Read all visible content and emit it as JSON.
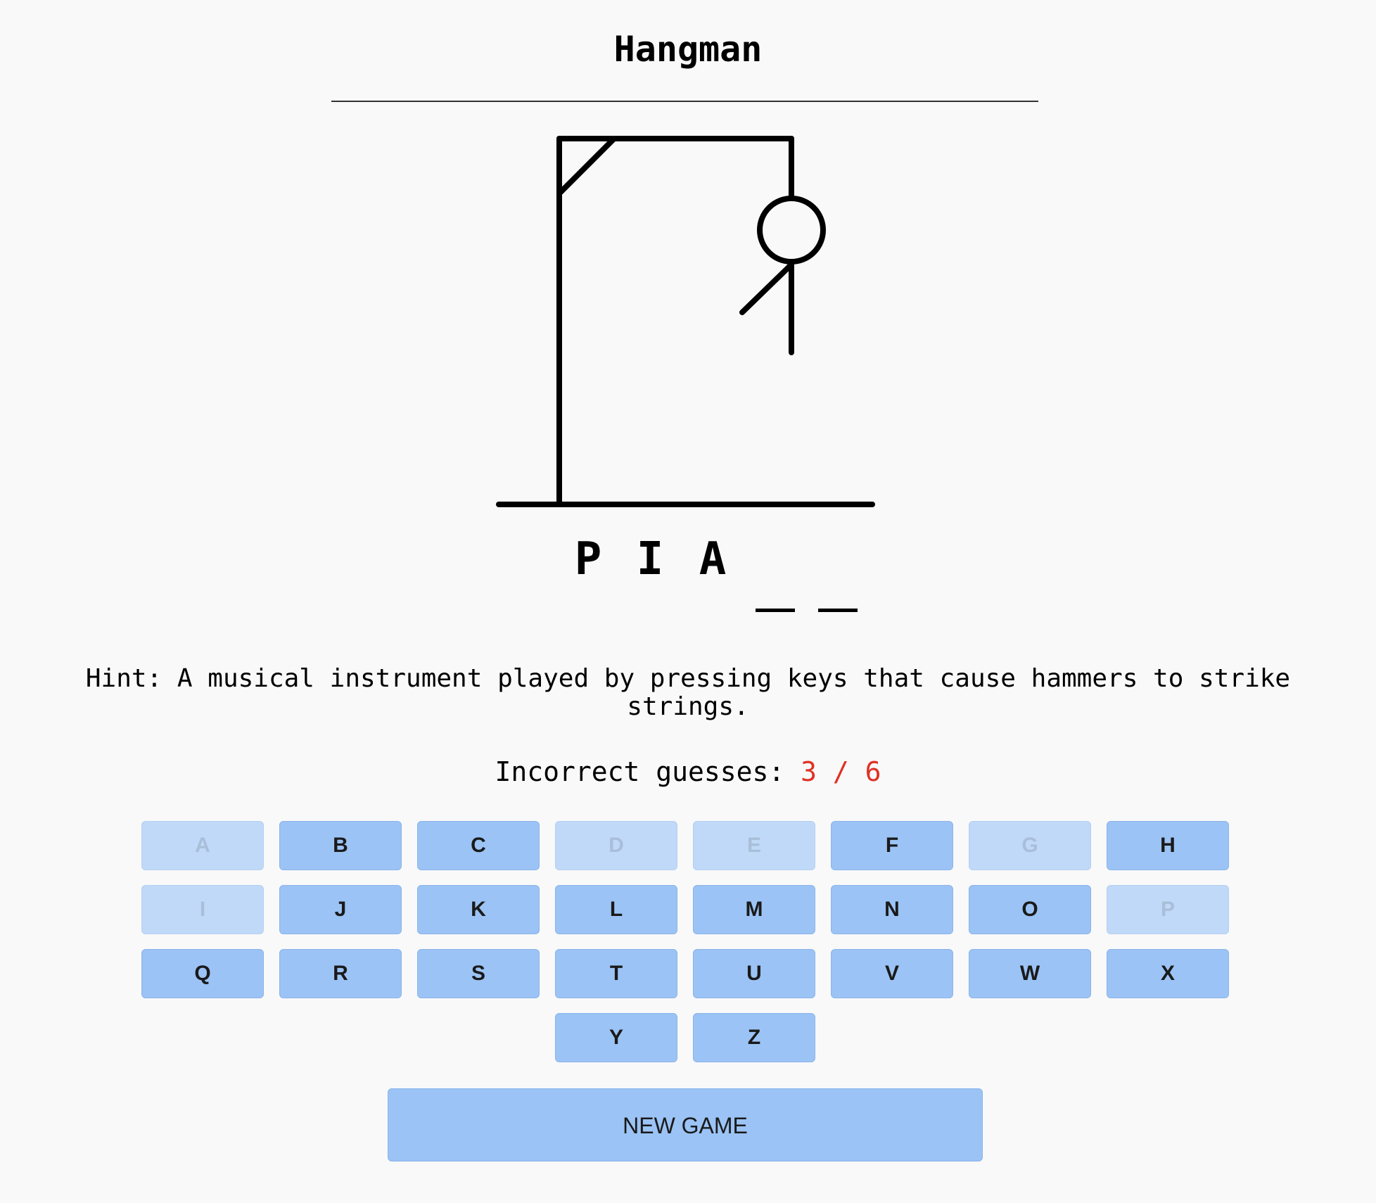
{
  "game": {
    "title": "Hangman",
    "hint_text": "Hint: A musical instrument played by pressing keys that cause hammers to strike strings.",
    "incorrect_label": "Incorrect guesses:",
    "incorrect_count": "3 / 6",
    "incorrect_guesses": 3,
    "max_guesses": 6,
    "word_slots": [
      {
        "char": "P",
        "revealed": true
      },
      {
        "char": "I",
        "revealed": true
      },
      {
        "char": "A",
        "revealed": true
      },
      {
        "char": "",
        "revealed": false
      },
      {
        "char": "",
        "revealed": false
      }
    ],
    "new_game_label": "NEW GAME"
  },
  "keyboard": {
    "keys": [
      {
        "label": "A",
        "used": true
      },
      {
        "label": "B",
        "used": false
      },
      {
        "label": "C",
        "used": false
      },
      {
        "label": "D",
        "used": true
      },
      {
        "label": "E",
        "used": true
      },
      {
        "label": "F",
        "used": false
      },
      {
        "label": "G",
        "used": true
      },
      {
        "label": "H",
        "used": false
      },
      {
        "label": "I",
        "used": true
      },
      {
        "label": "J",
        "used": false
      },
      {
        "label": "K",
        "used": false
      },
      {
        "label": "L",
        "used": false
      },
      {
        "label": "M",
        "used": false
      },
      {
        "label": "N",
        "used": false
      },
      {
        "label": "O",
        "used": false
      },
      {
        "label": "P",
        "used": true
      },
      {
        "label": "Q",
        "used": false
      },
      {
        "label": "R",
        "used": false
      },
      {
        "label": "S",
        "used": false
      },
      {
        "label": "T",
        "used": false
      },
      {
        "label": "U",
        "used": false
      },
      {
        "label": "V",
        "used": false
      },
      {
        "label": "W",
        "used": false
      },
      {
        "label": "X",
        "used": false
      },
      {
        "label": "Y",
        "used": false
      },
      {
        "label": "Z",
        "used": false
      }
    ]
  },
  "colors": {
    "key_active": "#9bc3f5",
    "key_used": "#c0d9f8",
    "count_accent": "#e03024"
  }
}
